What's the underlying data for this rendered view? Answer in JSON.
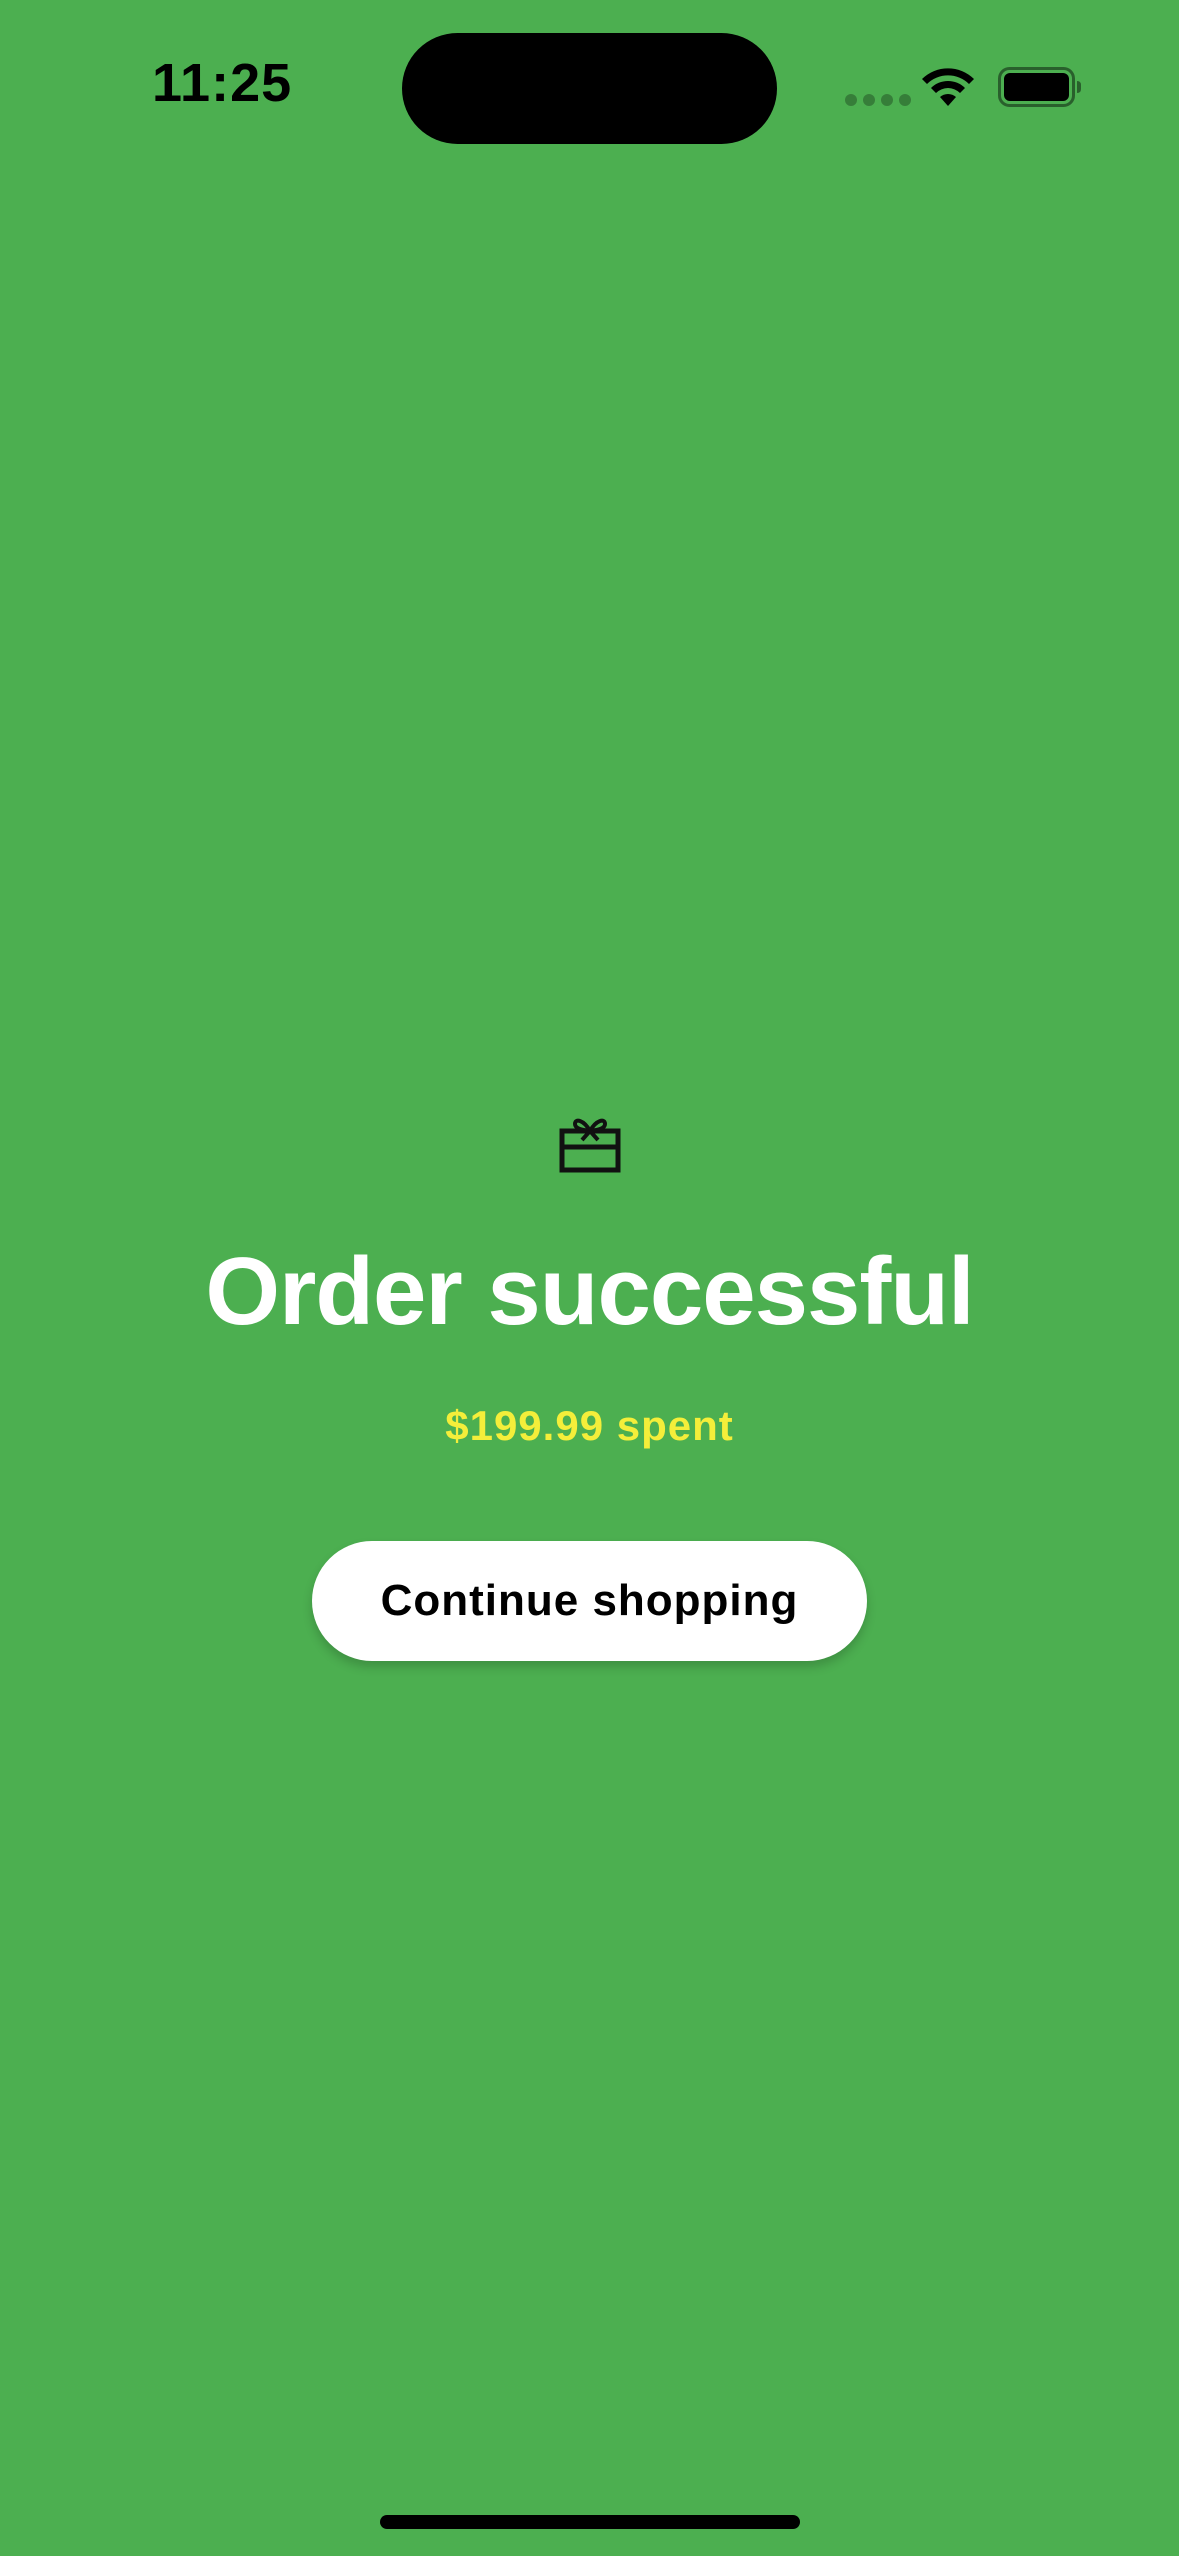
{
  "status_bar": {
    "time": "11:25"
  },
  "icons": {
    "gift": "gift-icon",
    "wifi": "wifi-icon",
    "battery": "battery-icon"
  },
  "main": {
    "title": "Order successful",
    "spent_text": "$199.99 spent",
    "continue_button_label": "Continue shopping"
  },
  "colors": {
    "background": "#4caf50",
    "title": "#ffffff",
    "spent": "#f4ee3a",
    "button_bg": "#ffffff",
    "button_text": "#000000"
  }
}
